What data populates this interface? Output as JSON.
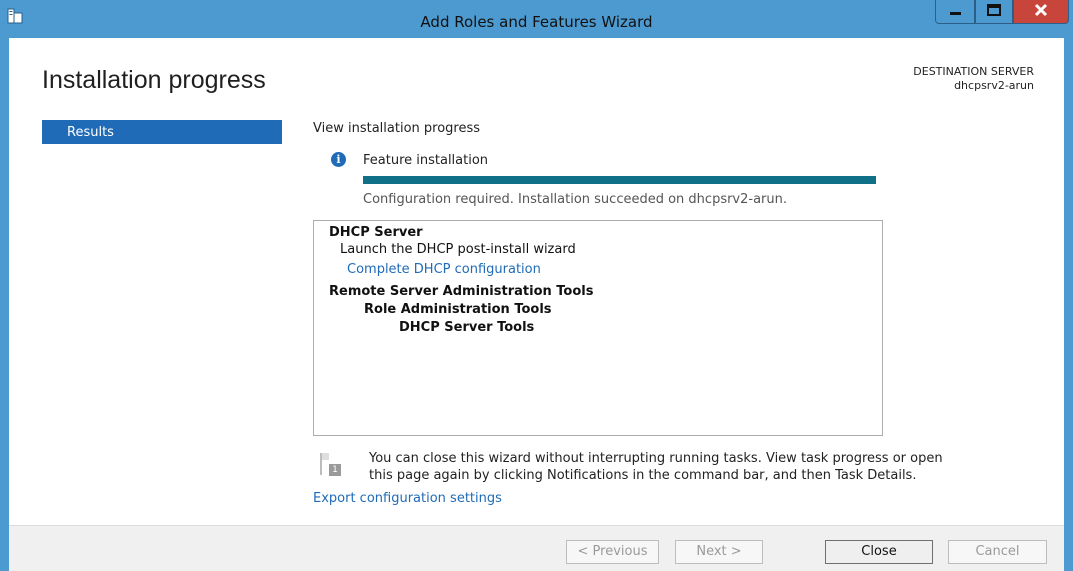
{
  "window": {
    "title": "Add Roles and Features Wizard",
    "buttons": {
      "minimize": "minimize-icon",
      "maximize": "maximize-icon",
      "close": "close-icon"
    }
  },
  "header": {
    "page_title": "Installation progress",
    "destination_label": "DESTINATION SERVER",
    "destination_server": "dhcpsrv2-arun"
  },
  "sidebar": {
    "items": [
      {
        "label": "Results",
        "selected": true
      }
    ]
  },
  "main": {
    "section_title": "View installation progress",
    "feature_label": "Feature installation",
    "progress_percent": 100,
    "status_text": "Configuration required. Installation succeeded on dhcpsrv2-arun.",
    "results": [
      {
        "text": "DHCP Server",
        "style": "bold",
        "indent": 0
      },
      {
        "text": "Launch the DHCP post-install wizard",
        "style": "normal",
        "indent": 1
      },
      {
        "text": "Complete DHCP configuration",
        "style": "link",
        "indent": 2
      },
      {
        "text": "Remote Server Administration Tools",
        "style": "bold",
        "indent": 0
      },
      {
        "text": "Role Administration Tools",
        "style": "bold",
        "indent": 2
      },
      {
        "text": "DHCP Server Tools",
        "style": "bold",
        "indent": 4
      }
    ],
    "note_icon_number": "1",
    "note_line1": "You can close this wizard without interrupting running tasks. View task progress or open",
    "note_line2": "this page again by clicking Notifications in the command bar, and then Task Details.",
    "export_link": "Export configuration settings"
  },
  "footer": {
    "previous": "< Previous",
    "next": "Next >",
    "close": "Close",
    "cancel": "Cancel"
  },
  "colors": {
    "title_bar": "#4d9ad0",
    "accent": "#1f6bb8",
    "progress": "#107087",
    "close_button": "#c7453a"
  }
}
